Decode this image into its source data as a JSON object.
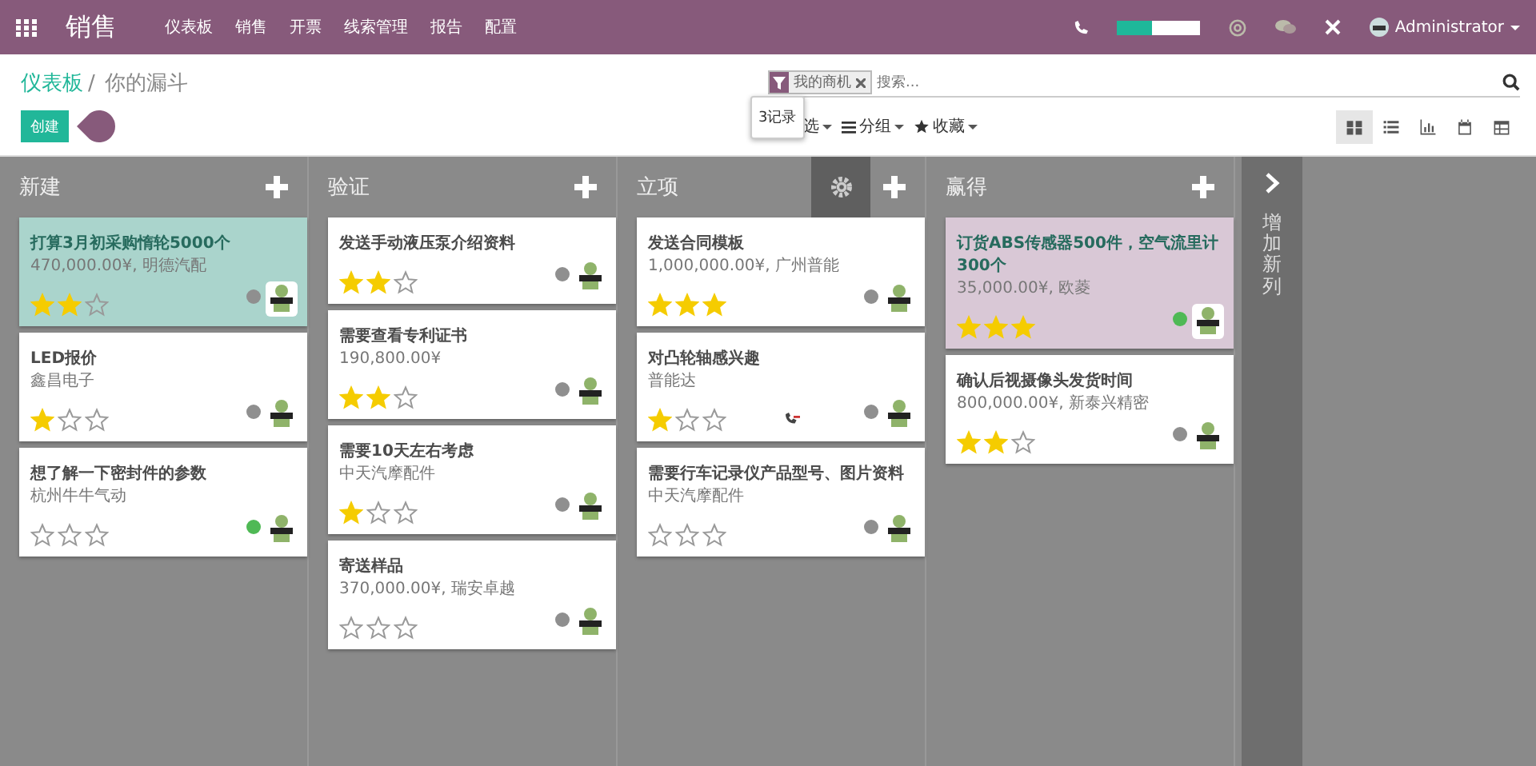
{
  "app_title": "销售",
  "menu": [
    "仪表板",
    "销售",
    "开票",
    "线索管理",
    "报告",
    "配置"
  ],
  "systray": {
    "progress": {
      "level": 0.42
    },
    "user": "Administrator"
  },
  "breadcrumbs": [
    {
      "label": "仪表板",
      "link": true
    },
    {
      "label": "你的漏斗",
      "link": false
    }
  ],
  "breadcrumb_separator": "/",
  "create_button": "创建",
  "search": {
    "facet": "我的商机",
    "placeholder": "搜索..."
  },
  "tooltip": "3记录",
  "toolbar": [
    {
      "label": "选",
      "kind": "filter"
    },
    {
      "label": "分组",
      "kind": "group"
    },
    {
      "label": "收藏",
      "kind": "favorite"
    }
  ],
  "views": [
    {
      "kind": "kanban",
      "selected": true
    },
    {
      "kind": "list",
      "selected": false
    },
    {
      "kind": "graph",
      "selected": false
    },
    {
      "kind": "calendar",
      "selected": false
    },
    {
      "kind": "pivot",
      "selected": false
    }
  ],
  "columns": [
    {
      "title": "新建",
      "settings_shown": false,
      "cards": [
        {
          "title": "打算3月初采购惰轮5000个",
          "subtitle": "470,000.00¥, 明德汽配",
          "stars": 2,
          "color": "#aad4cc",
          "status": {
            "color": "#8f8f8f"
          },
          "activity": false
        },
        {
          "title": "LED报价",
          "subtitle": "鑫昌电子",
          "stars": 1,
          "color": "#ffffff",
          "status": {
            "color": "#8f8f8f"
          },
          "activity": false
        },
        {
          "title": "想了解一下密封件的参数",
          "subtitle": "杭州牛牛气动",
          "stars": 0,
          "color": "#ffffff",
          "status": {
            "color": "#4fb955"
          },
          "activity": false
        }
      ]
    },
    {
      "title": "验证",
      "settings_shown": false,
      "cards": [
        {
          "title": "发送手动液压泵介绍资料",
          "stars": 2,
          "color": "#ffffff",
          "status": {
            "color": "#8f8f8f"
          },
          "activity": false
        },
        {
          "title": "需要查看专利证书",
          "subtitle": "190,800.00¥",
          "stars": 2,
          "color": "#ffffff",
          "status": {
            "color": "#8f8f8f"
          },
          "activity": false
        },
        {
          "title": "需要10天左右考虑",
          "subtitle": "中天汽摩配件",
          "stars": 1,
          "color": "#ffffff",
          "status": {
            "color": "#8f8f8f"
          },
          "activity": false
        },
        {
          "title": "寄送样品",
          "subtitle": "370,000.00¥, 瑞安卓越",
          "stars": 0,
          "color": "#ffffff",
          "status": {
            "color": "#8f8f8f"
          },
          "activity": false
        }
      ]
    },
    {
      "title": "立项",
      "settings_shown": true,
      "cards": [
        {
          "title": "发送合同模板",
          "subtitle": "1,000,000.00¥, 广州普能",
          "stars": 3,
          "color": "#ffffff",
          "status": {
            "color": "#8f8f8f"
          },
          "activity": false
        },
        {
          "title": "对凸轮轴感兴趣",
          "subtitle": "普能达",
          "stars": 1,
          "color": "#ffffff",
          "status": {
            "color": "#8f8f8f"
          },
          "activity": true
        },
        {
          "title": "需要行车记录仪产品型号、图片资料",
          "subtitle": "中天汽摩配件",
          "stars": 0,
          "color": "#ffffff",
          "status": {
            "color": "#8f8f8f"
          },
          "activity": false
        }
      ]
    },
    {
      "title": "赢得",
      "settings_shown": false,
      "cards": [
        {
          "title": "订货ABS传感器500件，空气流里计300个",
          "subtitle": "35,000.00¥, 欧菱",
          "stars": 3,
          "color": "#d9c8d6",
          "status": {
            "color": "#4fb955"
          },
          "activity": false
        },
        {
          "title": "确认后视摄像头发货时间",
          "subtitle": "800,000.00¥, 新泰兴精密",
          "stars": 2,
          "color": "#ffffff",
          "status": {
            "color": "#8f8f8f"
          },
          "activity": false
        }
      ]
    }
  ],
  "add_column": "增加新列"
}
